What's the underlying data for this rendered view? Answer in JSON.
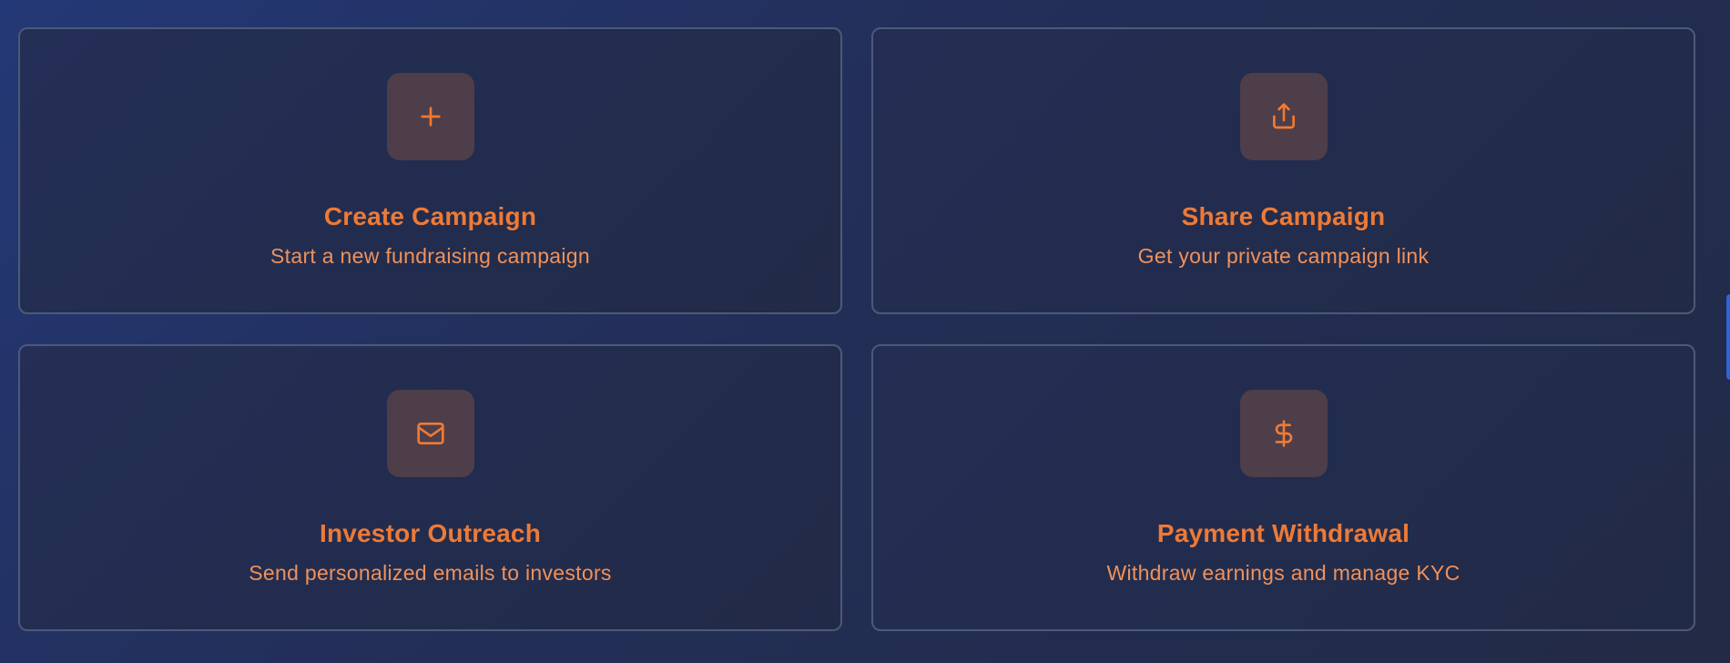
{
  "accent_color": "#ee7a36",
  "cards": [
    {
      "title": "Create Campaign",
      "subtitle": "Start a new fundraising campaign",
      "icon": "plus-icon"
    },
    {
      "title": "Share Campaign",
      "subtitle": "Get your private campaign link",
      "icon": "share-icon"
    },
    {
      "title": "Investor Outreach",
      "subtitle": "Send personalized emails to investors",
      "icon": "mail-icon"
    },
    {
      "title": "Payment Withdrawal",
      "subtitle": "Withdraw earnings and manage KYC",
      "icon": "dollar-icon"
    }
  ]
}
